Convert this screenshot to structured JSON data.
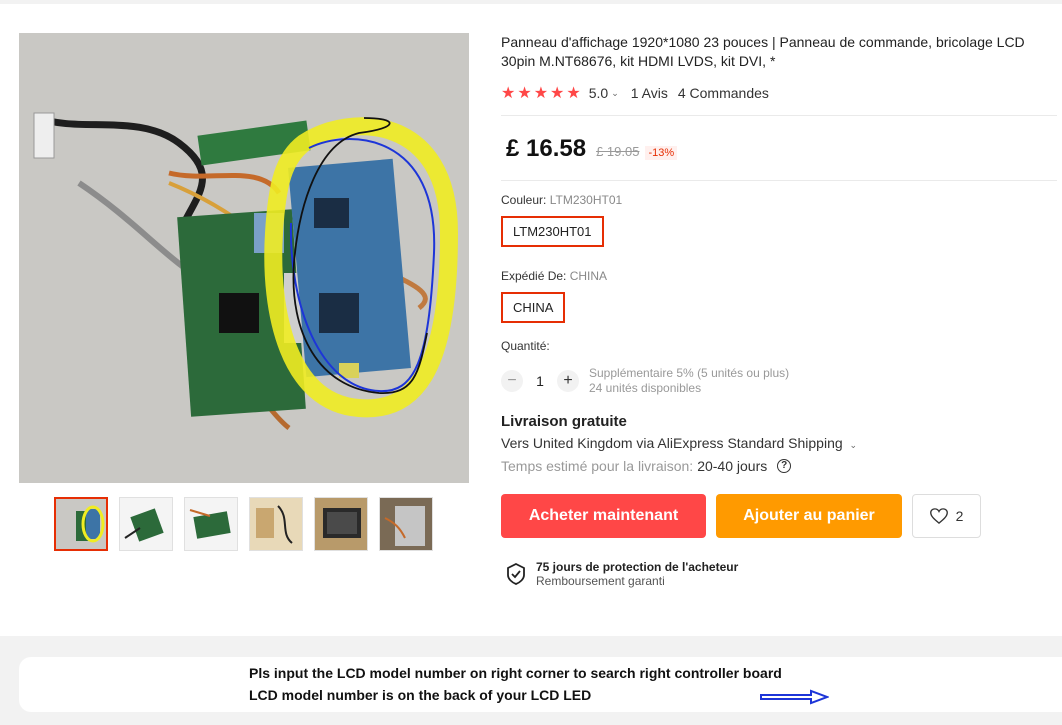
{
  "product": {
    "title": "Panneau d'affichage 1920*1080 23 pouces | Panneau de commande, bricolage LCD 30pin M.NT68676, kit HDMI LVDS, kit DVI, *",
    "rating": "5.0",
    "stars": 5,
    "reviews": "1 Avis",
    "orders": "4 Commandes"
  },
  "price": {
    "current": "£ 16.58",
    "original": "£ 19.05",
    "discount": "-13%"
  },
  "color": {
    "label": "Couleur: ",
    "value": "LTM230HT01",
    "chip": "LTM230HT01"
  },
  "ships_from": {
    "label": "Expédié De: ",
    "value": "CHINA",
    "chip": "CHINA"
  },
  "quantity": {
    "label": "Quantité:",
    "value": "1",
    "minus": "−",
    "plus": "+",
    "note1": "Supplémentaire 5% (5 unités ou plus)",
    "note2": "24 unités disponibles"
  },
  "shipping": {
    "title": "Livraison gratuite",
    "line": "Vers United Kingdom via AliExpress Standard Shipping",
    "time_label": "Temps estimé pour la livraison:",
    "time_value": "20-40 jours",
    "help": "?"
  },
  "actions": {
    "buy": "Acheter maintenant",
    "cart": "Ajouter au panier",
    "wishlist_count": "2"
  },
  "protection": {
    "title": "75 jours de protection de l'acheteur",
    "subtitle": "Remboursement garanti"
  },
  "banner": {
    "line1": "Pls input the LCD model number on right corner to search right controller board",
    "line2": "LCD model number is on the back of your LCD LED"
  },
  "colors": {
    "accent_red": "#ff4747",
    "accent_orange": "#ff9a00",
    "chip_border": "#e62e04"
  }
}
